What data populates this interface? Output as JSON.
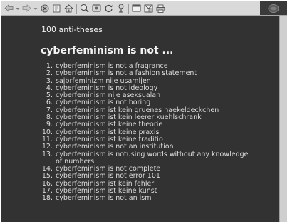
{
  "toolbar": {
    "buttons": [
      {
        "name": "back-icon"
      },
      {
        "name": "forward-icon"
      },
      {
        "name": "stop-icon"
      },
      {
        "name": "reload-icon"
      },
      {
        "name": "home-icon"
      },
      {
        "name": "search-icon"
      },
      {
        "name": "favorites-icon"
      },
      {
        "name": "history-icon"
      },
      {
        "name": "channels-icon"
      },
      {
        "name": "fullscreen-icon"
      },
      {
        "name": "mail-icon"
      },
      {
        "name": "print-icon"
      }
    ]
  },
  "page": {
    "kicker": "100 anti-theses",
    "headline": "cyberfeminism is not ...",
    "theses": [
      {
        "num": "1.",
        "text": "cyberfeminism is not a fragrance"
      },
      {
        "num": "2.",
        "text": "cyberfeminism is not a fashion statement"
      },
      {
        "num": "3.",
        "text": "sajbrfeminizm nije usamljen"
      },
      {
        "num": "4.",
        "text": "cyberfeminism is not ideology"
      },
      {
        "num": "5.",
        "text": "cyberfeminism nije aseksualan"
      },
      {
        "num": "6.",
        "text": "cyberfeminism is not boring"
      },
      {
        "num": "7.",
        "text": "cyberfeminism ist kein gruenes haekeldeckchen"
      },
      {
        "num": "8.",
        "text": "cyberfeminism ist kein leerer kuehlschrank"
      },
      {
        "num": "9.",
        "text": "cyberfeminism ist keine theorie"
      },
      {
        "num": "10.",
        "text": "cyberfeminism ist keine praxis"
      },
      {
        "num": "11.",
        "text": "cyberfeminism ist keine traditio"
      },
      {
        "num": "12.",
        "text": "cyberfeminism is not an institution"
      },
      {
        "num": "13.",
        "text": "cyberfeminism is notusing words without any knowledge of numbers"
      },
      {
        "num": "14.",
        "text": "cyberfeminism is not complete"
      },
      {
        "num": "15.",
        "text": "cyberfeminism is not error 101"
      },
      {
        "num": "16.",
        "text": "cyberfeminism ist kein fehler"
      },
      {
        "num": "17.",
        "text": "cyberfeminism ist keine kunst"
      },
      {
        "num": "18.",
        "text": "cyberfeminism is not an ism"
      }
    ]
  }
}
